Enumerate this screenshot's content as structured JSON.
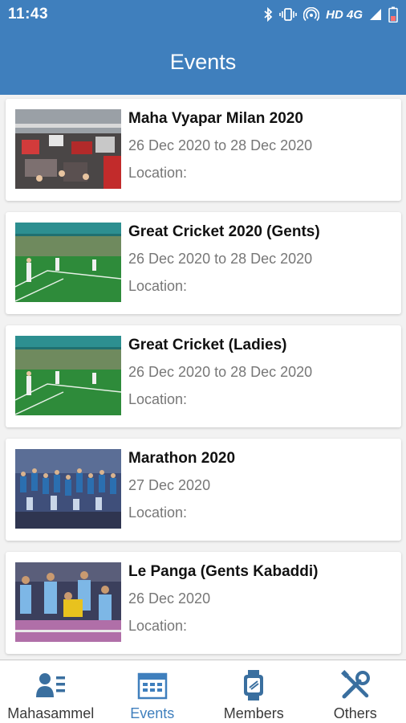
{
  "status_bar": {
    "time": "11:43",
    "network_label": "HD 4G",
    "icons": [
      "bluetooth-icon",
      "vibrate-icon",
      "hotspot-icon",
      "signal-icon",
      "battery-icon"
    ]
  },
  "app_bar": {
    "title": "Events"
  },
  "events": [
    {
      "title": "Maha Vyapar Milan 2020",
      "date": "26 Dec 2020  to  28 Dec 2020",
      "location": "Location:",
      "image": "exhibition-photo"
    },
    {
      "title": "Great Cricket 2020 (Gents)",
      "date": "26 Dec 2020  to  28 Dec 2020",
      "location": "Location:",
      "image": "cricket-photo"
    },
    {
      "title": "Great Cricket (Ladies)",
      "date": "26 Dec 2020  to  28 Dec 2020",
      "location": "Location:",
      "image": "cricket-photo"
    },
    {
      "title": "Marathon 2020",
      "date": "27 Dec 2020",
      "location": "Location:",
      "image": "marathon-photo"
    },
    {
      "title": "Le Panga (Gents Kabaddi)",
      "date": "26 Dec 2020",
      "location": "Location:",
      "image": "kabaddi-photo"
    }
  ],
  "bottom_nav": {
    "items": [
      {
        "label": "Mahasammel",
        "icon": "profile-list-icon",
        "active": false
      },
      {
        "label": "Events",
        "icon": "calendar-icon",
        "active": true
      },
      {
        "label": "Members",
        "icon": "watch-icon",
        "active": false
      },
      {
        "label": "Others",
        "icon": "tools-icon",
        "active": false
      }
    ]
  },
  "colors": {
    "primary": "#3f7fbd",
    "nav_icon": "#3a6f9f",
    "text_dark": "#111111",
    "text_muted": "#777777"
  }
}
